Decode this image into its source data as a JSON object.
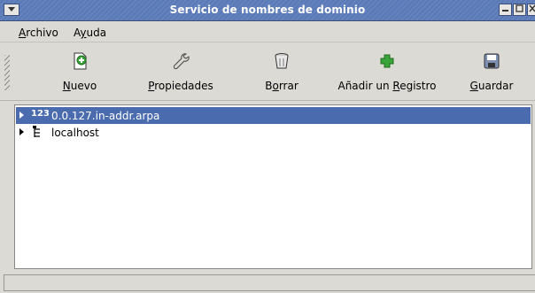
{
  "window": {
    "title": "Servicio de nombres de dominio"
  },
  "menu": {
    "items": [
      {
        "label": "Archivo",
        "mnemonic": "A"
      },
      {
        "label": "Ayuda",
        "mnemonic": "y"
      }
    ]
  },
  "toolbar": {
    "buttons": [
      {
        "id": "new",
        "label": "Nuevo",
        "icon": "new-document-icon"
      },
      {
        "id": "properties",
        "label": "Propiedades",
        "icon": "wrench-icon"
      },
      {
        "id": "delete",
        "label": "Borrar",
        "icon": "trash-icon"
      },
      {
        "id": "add_record",
        "label": "Añadir un Registro",
        "icon": "plus-icon"
      },
      {
        "id": "save",
        "label": "Guardar",
        "icon": "floppy-disk-icon"
      }
    ]
  },
  "zones": {
    "rows": [
      {
        "label": "0.0.127.in-addr.arpa",
        "icon": "reverse-zone-123-icon",
        "selected": true,
        "expander": "collapsed"
      },
      {
        "label": "localhost",
        "icon": "tree-zone-icon",
        "selected": false,
        "expander": "collapsed"
      }
    ]
  },
  "status": {
    "text": ""
  },
  "colors": {
    "titlebar": "#5a7ab8",
    "selection": "#4a6cae",
    "window_bg": "#dcdad5",
    "add_icon_green": "#3aa33a"
  }
}
